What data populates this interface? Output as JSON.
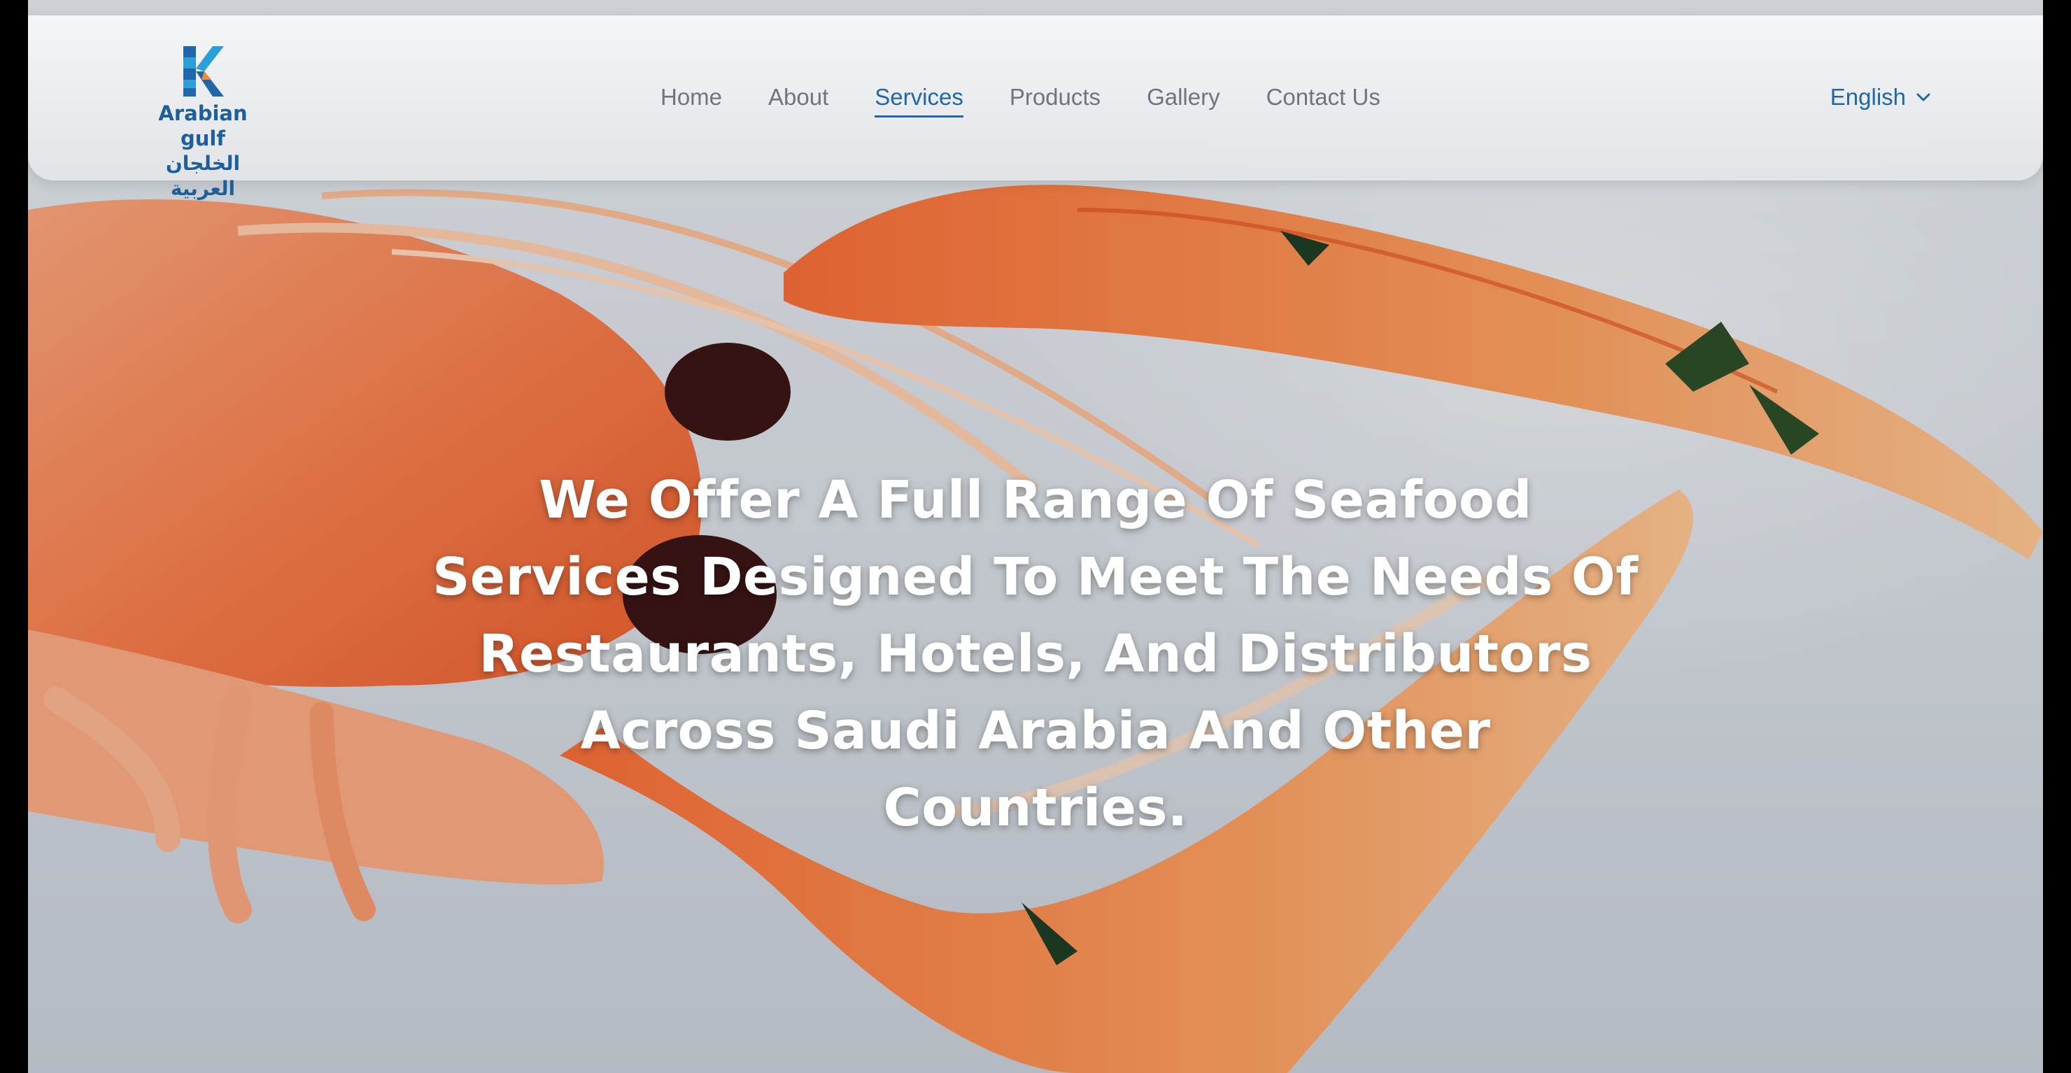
{
  "brand": {
    "name_en": "Arabian gulf",
    "name_ar": "الخلجان العربية",
    "logo_icon": "k-mosaic-logo-icon",
    "colors": {
      "primary": "#1f67a9",
      "accent": "#2a9fd8"
    }
  },
  "nav": {
    "items": [
      {
        "label": "Home",
        "active": false
      },
      {
        "label": "About",
        "active": false
      },
      {
        "label": "Services",
        "active": true
      },
      {
        "label": "Products",
        "active": false
      },
      {
        "label": "Gallery",
        "active": false
      },
      {
        "label": "Contact Us",
        "active": false
      }
    ],
    "language": {
      "label": "English",
      "icon": "chevron-down-icon"
    }
  },
  "hero": {
    "heading": "We Offer A Full Range Of Seafood Services Designed To Meet The Needs Of Restaurants, Hotels, And Distributors Across Saudi Arabia And Other Countries.",
    "image": "langoustine-on-white-plate"
  }
}
